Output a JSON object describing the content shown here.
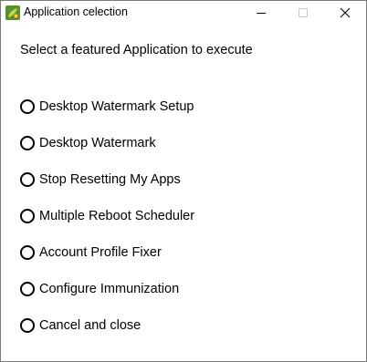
{
  "window": {
    "title": "Application celection",
    "icon": "app-leaf-icon"
  },
  "controls": {
    "minimize_icon": "minimize-icon",
    "maximize_icon": "maximize-icon",
    "close_icon": "close-icon"
  },
  "prompt": "Select a featured Application to execute",
  "options": [
    {
      "label": "Desktop Watermark Setup",
      "selected": false
    },
    {
      "label": "Desktop Watermark",
      "selected": false
    },
    {
      "label": "Stop Resetting My Apps",
      "selected": false
    },
    {
      "label": "Multiple Reboot Scheduler",
      "selected": false
    },
    {
      "label": "Account Profile Fixer",
      "selected": false
    },
    {
      "label": "Configure Immunization",
      "selected": false
    },
    {
      "label": "Cancel and close",
      "selected": false
    }
  ],
  "colors": {
    "icon_bg": "#5a8f29",
    "icon_accent": "#f2c94c",
    "disabled_control": "#c8c8c8"
  }
}
